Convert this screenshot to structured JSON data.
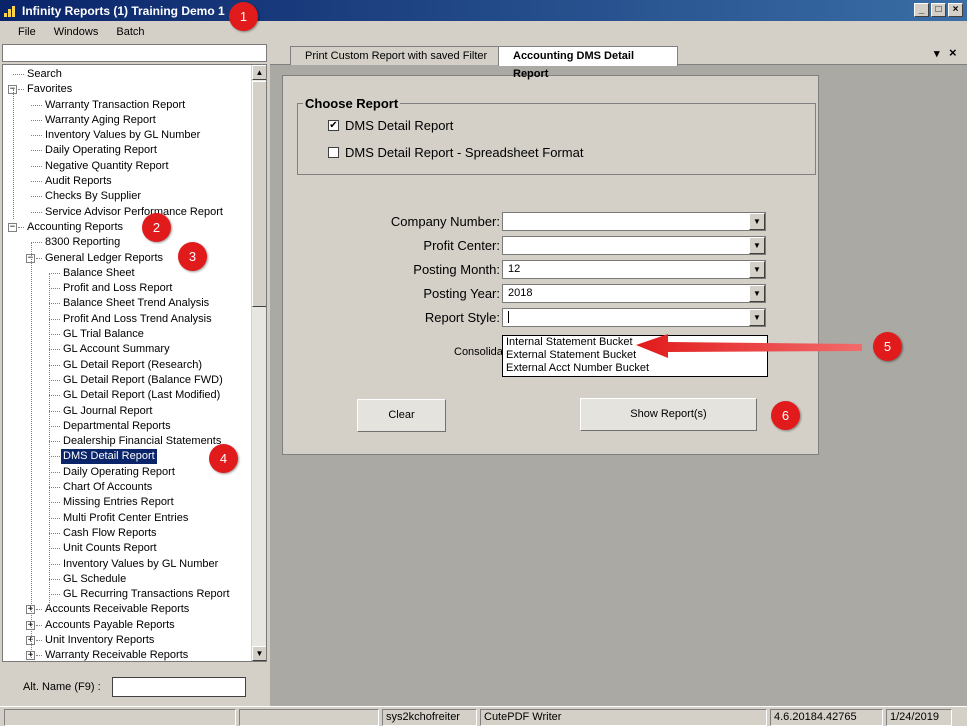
{
  "window": {
    "title": "Infinity Reports (1) Training Demo 1",
    "controls": {
      "minimize": "_",
      "maximize": "□",
      "close": "×"
    }
  },
  "menu": [
    "File",
    "Windows",
    "Batch"
  ],
  "tree": {
    "items": [
      {
        "label": "Search",
        "level": 0,
        "expander": ""
      },
      {
        "label": "Favorites",
        "level": 0,
        "expander": "−"
      },
      {
        "label": "Warranty Transaction Report",
        "level": 1,
        "expander": ""
      },
      {
        "label": "Warranty Aging Report",
        "level": 1,
        "expander": ""
      },
      {
        "label": "Inventory Values by GL Number",
        "level": 1,
        "expander": ""
      },
      {
        "label": "Daily Operating Report",
        "level": 1,
        "expander": ""
      },
      {
        "label": "Negative Quantity Report",
        "level": 1,
        "expander": ""
      },
      {
        "label": "Audit Reports",
        "level": 1,
        "expander": ""
      },
      {
        "label": "Checks By Supplier",
        "level": 1,
        "expander": ""
      },
      {
        "label": "Service Advisor Performance Report",
        "level": 1,
        "expander": ""
      },
      {
        "label": "Accounting Reports",
        "level": 0,
        "expander": "−"
      },
      {
        "label": "8300 Reporting",
        "level": 1,
        "expander": ""
      },
      {
        "label": "General Ledger Reports",
        "level": 1,
        "expander": "−"
      },
      {
        "label": "Balance Sheet",
        "level": 2,
        "expander": ""
      },
      {
        "label": "Profit and Loss Report",
        "level": 2,
        "expander": ""
      },
      {
        "label": "Balance Sheet Trend Analysis",
        "level": 2,
        "expander": ""
      },
      {
        "label": "Profit And Loss Trend Analysis",
        "level": 2,
        "expander": ""
      },
      {
        "label": "GL Trial Balance",
        "level": 2,
        "expander": ""
      },
      {
        "label": "GL Account Summary",
        "level": 2,
        "expander": ""
      },
      {
        "label": "GL Detail Report (Research)",
        "level": 2,
        "expander": ""
      },
      {
        "label": "GL Detail Report (Balance FWD)",
        "level": 2,
        "expander": ""
      },
      {
        "label": "GL Detail Report (Last Modified)",
        "level": 2,
        "expander": ""
      },
      {
        "label": "GL Journal Report",
        "level": 2,
        "expander": ""
      },
      {
        "label": "Departmental Reports",
        "level": 2,
        "expander": ""
      },
      {
        "label": "Dealership Financial Statements",
        "level": 2,
        "expander": ""
      },
      {
        "label": "DMS Detail Report",
        "level": 2,
        "expander": "",
        "selected": true
      },
      {
        "label": "Daily Operating Report",
        "level": 2,
        "expander": ""
      },
      {
        "label": "Chart Of Accounts",
        "level": 2,
        "expander": ""
      },
      {
        "label": "Missing Entries Report",
        "level": 2,
        "expander": ""
      },
      {
        "label": "Multi Profit Center Entries",
        "level": 2,
        "expander": ""
      },
      {
        "label": "Cash Flow Reports",
        "level": 2,
        "expander": ""
      },
      {
        "label": "Unit Counts Report",
        "level": 2,
        "expander": ""
      },
      {
        "label": "Inventory Values by GL Number",
        "level": 2,
        "expander": ""
      },
      {
        "label": "GL Schedule",
        "level": 2,
        "expander": ""
      },
      {
        "label": "GL Recurring Transactions Report",
        "level": 2,
        "expander": ""
      },
      {
        "label": "Accounts Receivable Reports",
        "level": 1,
        "expander": "+"
      },
      {
        "label": "Accounts Payable Reports",
        "level": 1,
        "expander": "+"
      },
      {
        "label": "Unit Inventory Reports",
        "level": 1,
        "expander": "+"
      },
      {
        "label": "Warranty Receivable Reports",
        "level": 1,
        "expander": "+"
      }
    ]
  },
  "alt_name": {
    "label": "Alt. Name (F9) :",
    "value": ""
  },
  "tabs": [
    {
      "label": "Print Custom Report with saved Filter",
      "active": false
    },
    {
      "label": "Accounting DMS Detail Report",
      "active": true
    }
  ],
  "tab_controls": {
    "menu": "▾",
    "close": "×"
  },
  "choose_report": {
    "title": "Choose Report",
    "options": [
      {
        "label": "DMS Detail Report",
        "checked": true,
        "mark": "✔"
      },
      {
        "label": "DMS Detail Report - Spreadsheet Format",
        "checked": false,
        "mark": ""
      }
    ]
  },
  "fields": {
    "company_number": {
      "label": "Company Number:",
      "value": ""
    },
    "profit_center": {
      "label": "Profit Center:",
      "value": ""
    },
    "posting_month": {
      "label": "Posting Month:",
      "value": "12"
    },
    "posting_year": {
      "label": "Posting Year:",
      "value": "2018"
    },
    "report_style": {
      "label": "Report Style:",
      "value": ""
    },
    "consolidate": {
      "label": "Consolidate"
    }
  },
  "report_style_options": [
    "Internal Statement Bucket",
    "External Statement Bucket",
    "External Acct Number Bucket"
  ],
  "buttons": {
    "clear": "Clear",
    "show": "Show Report(s)"
  },
  "badges": [
    "1",
    "2",
    "3",
    "4",
    "5",
    "6"
  ],
  "colors": {
    "badge": "#e11b1b",
    "title_bar": "#0a246a",
    "selection": "#0a246a",
    "arrow": "#e11b1b"
  },
  "status": {
    "user": "sys2kchofreiter",
    "printer": "CutePDF Writer",
    "version": "4.6.20184.42765",
    "date": "1/24/2019"
  }
}
